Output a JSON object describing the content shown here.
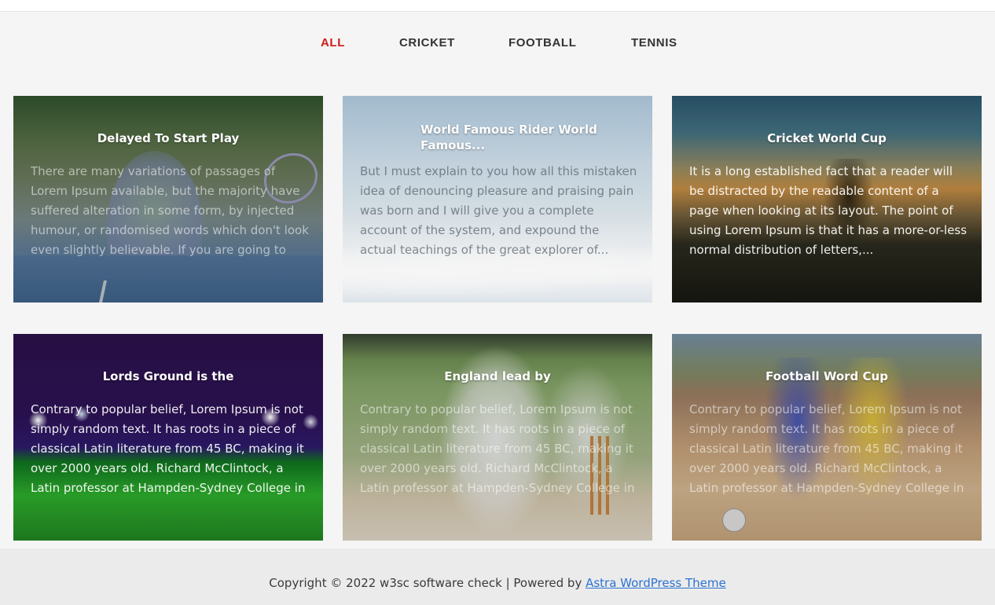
{
  "filters": {
    "all": "ALL",
    "cricket": "CRICKET",
    "football": "FOOTBALL",
    "tennis": "TENNIS",
    "active_color": "#d11a1a"
  },
  "cards": [
    {
      "title": "Delayed To Start Play",
      "description": "There are many variations of passages of Lorem Ipsum available, but the majority have suffered alteration in some form, by injected humour, or randomised words which don't look even slightly believable. If you are going to use a passage of..."
    },
    {
      "title": "World Famous Rider World Famous...",
      "description": "But I must explain to you how all this mistaken idea of denouncing pleasure and praising pain was born and I will give you a complete account of the system, and expound the actual teachings of the great explorer of..."
    },
    {
      "title": "Cricket World Cup",
      "description": "It is a long established fact that a reader will be distracted by the readable content of a page when looking at its layout. The point of using Lorem Ipsum is that it has a more-or-less normal distribution of letters,..."
    },
    {
      "title": "Lords Ground is the",
      "description": "Contrary to popular belief, Lorem Ipsum is not simply random text. It has roots in a piece of classical Latin literature from 45 BC, making it over 2000 years old. Richard McClintock, a Latin professor at Hampden-Sydney College in Virginia,..."
    },
    {
      "title": "England lead by",
      "description": "Contrary to popular belief, Lorem Ipsum is not simply random text. It has roots in a piece of classical Latin literature from 45 BC, making it over 2000 years old. Richard McClintock, a Latin professor at Hampden-Sydney College in Virginia,..."
    },
    {
      "title": "Football Word Cup",
      "description": "Contrary to popular belief, Lorem Ipsum is not simply random text. It has roots in a piece of classical Latin literature from 45 BC, making it over 2000 years old. Richard McClintock, a Latin professor at Hampden-Sydney College in Virginia,..."
    }
  ],
  "footer": {
    "text": "Copyright © 2022 w3sc software check | Powered by ",
    "link": "Astra WordPress Theme"
  }
}
